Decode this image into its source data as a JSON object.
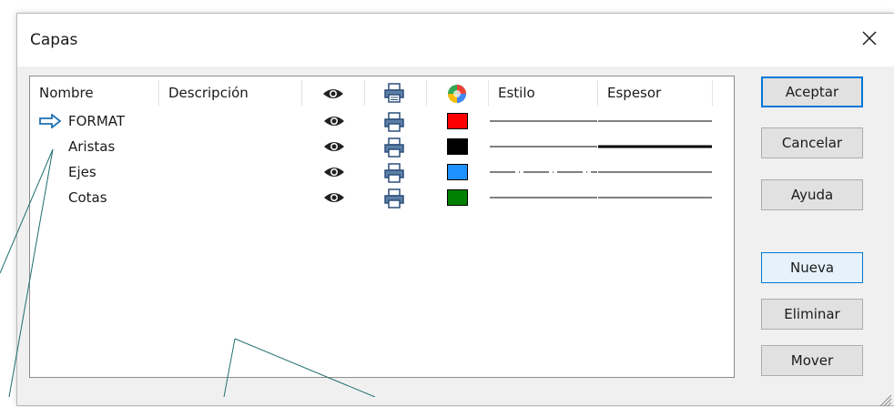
{
  "window": {
    "title": "Capas"
  },
  "columns": {
    "name": "Nombre",
    "description": "Descripción",
    "visible_icon": "eye-icon",
    "print_icon": "printer-icon",
    "color_icon": "color-wheel-icon",
    "style": "Estilo",
    "thickness": "Espesor"
  },
  "layers": [
    {
      "name": "FORMAT",
      "description": "",
      "current": true,
      "visible": true,
      "printable": true,
      "color": "#ff0000",
      "style": "solid",
      "thickness": "thin"
    },
    {
      "name": "Aristas",
      "description": "",
      "current": false,
      "visible": true,
      "printable": true,
      "color": "#000000",
      "style": "solid",
      "thickness": "thick"
    },
    {
      "name": "Ejes",
      "description": "",
      "current": false,
      "visible": true,
      "printable": true,
      "color": "#1e90ff",
      "style": "dash-dot",
      "thickness": "thin"
    },
    {
      "name": "Cotas",
      "description": "",
      "current": false,
      "visible": true,
      "printable": true,
      "color": "#008000",
      "style": "solid",
      "thickness": "thin"
    }
  ],
  "buttons": {
    "accept": "Aceptar",
    "cancel": "Cancelar",
    "help": "Ayuda",
    "new": "Nueva",
    "delete": "Eliminar",
    "move": "Mover"
  },
  "colors": {
    "accent": "#0078d7",
    "leader_lines": "#1f6f6f"
  }
}
